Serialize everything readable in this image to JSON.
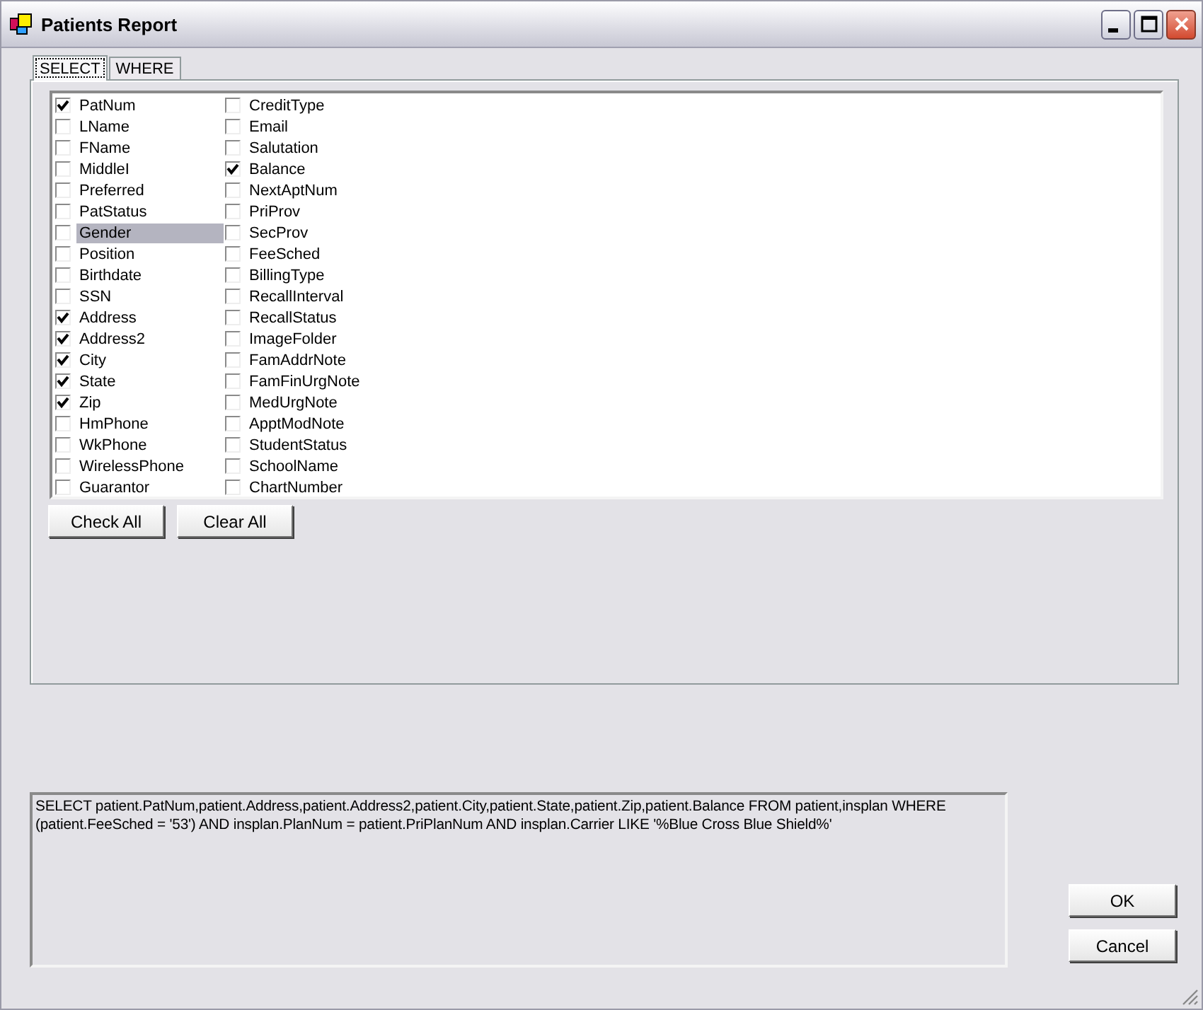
{
  "window": {
    "title": "Patients Report"
  },
  "tabs": [
    {
      "label": "SELECT",
      "selected": true
    },
    {
      "label": "WHERE",
      "selected": false
    }
  ],
  "fields": [
    {
      "label": "PatNum",
      "checked": true,
      "selected": false
    },
    {
      "label": "LName",
      "checked": false,
      "selected": false
    },
    {
      "label": "FName",
      "checked": false,
      "selected": false
    },
    {
      "label": "MiddleI",
      "checked": false,
      "selected": false
    },
    {
      "label": "Preferred",
      "checked": false,
      "selected": false
    },
    {
      "label": "PatStatus",
      "checked": false,
      "selected": false
    },
    {
      "label": "Gender",
      "checked": false,
      "selected": true
    },
    {
      "label": "Position",
      "checked": false,
      "selected": false
    },
    {
      "label": "Birthdate",
      "checked": false,
      "selected": false
    },
    {
      "label": "SSN",
      "checked": false,
      "selected": false
    },
    {
      "label": "Address",
      "checked": true,
      "selected": false
    },
    {
      "label": "Address2",
      "checked": true,
      "selected": false
    },
    {
      "label": "City",
      "checked": true,
      "selected": false
    },
    {
      "label": "State",
      "checked": true,
      "selected": false
    },
    {
      "label": "Zip",
      "checked": true,
      "selected": false
    },
    {
      "label": "HmPhone",
      "checked": false,
      "selected": false
    },
    {
      "label": "WkPhone",
      "checked": false,
      "selected": false
    },
    {
      "label": "WirelessPhone",
      "checked": false,
      "selected": false
    },
    {
      "label": "Guarantor",
      "checked": false,
      "selected": false
    },
    {
      "label": "CreditType",
      "checked": false,
      "selected": false
    },
    {
      "label": "Email",
      "checked": false,
      "selected": false
    },
    {
      "label": "Salutation",
      "checked": false,
      "selected": false
    },
    {
      "label": "Balance",
      "checked": true,
      "selected": false
    },
    {
      "label": "NextAptNum",
      "checked": false,
      "selected": false
    },
    {
      "label": "PriProv",
      "checked": false,
      "selected": false
    },
    {
      "label": "SecProv",
      "checked": false,
      "selected": false
    },
    {
      "label": "FeeSched",
      "checked": false,
      "selected": false
    },
    {
      "label": "BillingType",
      "checked": false,
      "selected": false
    },
    {
      "label": "RecallInterval",
      "checked": false,
      "selected": false
    },
    {
      "label": "RecallStatus",
      "checked": false,
      "selected": false
    },
    {
      "label": "ImageFolder",
      "checked": false,
      "selected": false
    },
    {
      "label": "FamAddrNote",
      "checked": false,
      "selected": false
    },
    {
      "label": "FamFinUrgNote",
      "checked": false,
      "selected": false
    },
    {
      "label": "MedUrgNote",
      "checked": false,
      "selected": false
    },
    {
      "label": "ApptModNote",
      "checked": false,
      "selected": false
    },
    {
      "label": "StudentStatus",
      "checked": false,
      "selected": false
    },
    {
      "label": "SchoolName",
      "checked": false,
      "selected": false
    },
    {
      "label": "ChartNumber",
      "checked": false,
      "selected": false
    }
  ],
  "list_buttons": [
    "Check All",
    "Clear All"
  ],
  "query": "SELECT patient.PatNum,patient.Address,patient.Address2,patient.City,patient.State,patient.Zip,patient.Balance FROM patient,insplan WHERE (patient.FeeSched = '53') AND insplan.PlanNum = patient.PriPlanNum AND insplan.Carrier LIKE '%Blue Cross Blue Shield%'",
  "buttons": [
    "OK",
    "Cancel"
  ]
}
